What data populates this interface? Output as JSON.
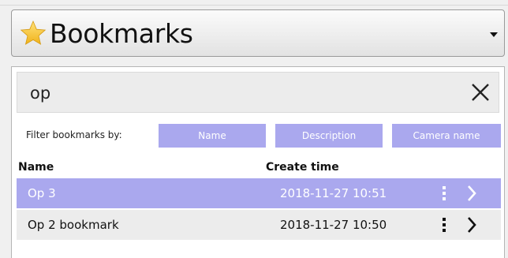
{
  "header": {
    "title": "Bookmarks",
    "icon": "star-icon",
    "star_color": "#f7c52b"
  },
  "search": {
    "value": "op",
    "clear_icon": "close-icon"
  },
  "filter": {
    "label": "Filter bookmarks by:",
    "buttons": [
      "Name",
      "Description",
      "Camera name"
    ],
    "button_color": "#aaa8ee"
  },
  "table": {
    "columns": [
      "Name",
      "Create time"
    ],
    "rows": [
      {
        "name": "Op 3",
        "create_time": "2018-11-27 10:51",
        "selected": true
      },
      {
        "name": "Op 2 bookmark",
        "create_time": "2018-11-27 10:50",
        "selected": false
      }
    ],
    "selected_color": "#aaa8ee"
  }
}
